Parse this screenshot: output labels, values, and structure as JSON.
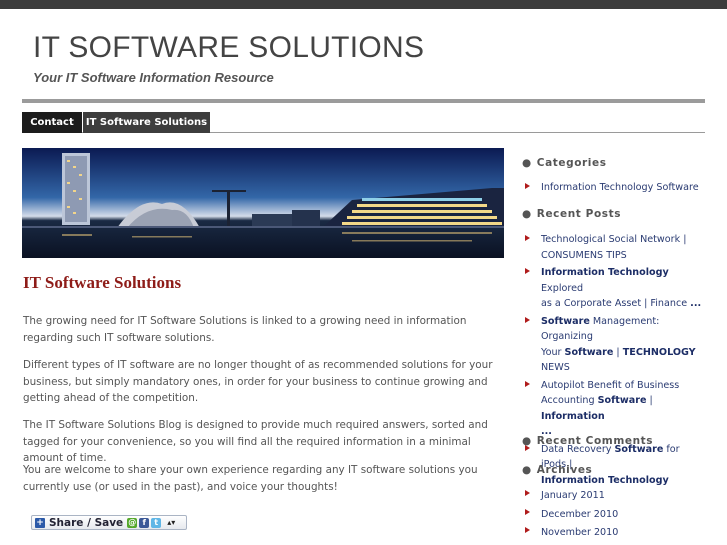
{
  "site": {
    "title": "IT SOFTWARE SOLUTIONS",
    "tagline": "Your IT Software Information Resource"
  },
  "nav": {
    "items": [
      "Contact",
      "IT Software Solutions"
    ]
  },
  "post": {
    "title": "IT Software Solutions",
    "paragraphs": [
      "The growing need for IT Software Solutions is linked to a growing need in information regarding such IT software solutions.",
      "Different types of IT software are no longer thought of as recommended solutions for your business, but simply  mandatory ones, in order for your business to continue growing and getting ahead of the competition.",
      "The IT Software Solutions Blog is designed to provide much required answers, sorted and tagged for your convenience, so you will find all the required information in a minimal amount of time.",
      "You are welcome to share your own experience regarding any IT software solutions you currently use (or used in the past), and voice your thoughts!"
    ],
    "share_label": "Share / Save",
    "share_arrows": "▴▾"
  },
  "sidebar": {
    "bullet": "●",
    "categories": {
      "heading": "Categories",
      "items": [
        "Information Technology Software"
      ]
    },
    "recent_posts": {
      "heading": "Recent Posts",
      "items": [
        {
          "lines": [
            [
              {
                "t": "Technological Social Network |",
                "b": false
              }
            ],
            [
              {
                "t": "CONSUMENS TIPS",
                "b": false
              }
            ]
          ]
        },
        {
          "lines": [
            [
              {
                "t": "Information Technology",
                "b": true
              },
              {
                "t": " Explored",
                "b": false
              }
            ],
            [
              {
                "t": "as a Corporate Asset | Finance ",
                "b": false
              },
              {
                "t": "...",
                "b": true
              }
            ]
          ]
        },
        {
          "lines": [
            [
              {
                "t": "Software",
                "b": true
              },
              {
                "t": " Management: Organizing",
                "b": false
              }
            ],
            [
              {
                "t": "Your ",
                "b": false
              },
              {
                "t": "Software",
                "b": true
              },
              {
                "t": " | ",
                "b": false
              },
              {
                "t": "TECHNOLOGY",
                "b": true
              }
            ],
            [
              {
                "t": "NEWS",
                "b": false
              }
            ]
          ]
        },
        {
          "lines": [
            [
              {
                "t": "Autopilot Benefit of Business",
                "b": false
              }
            ],
            [
              {
                "t": "Accounting ",
                "b": false
              },
              {
                "t": "Software",
                "b": true
              },
              {
                "t": " | ",
                "b": false
              },
              {
                "t": "Information",
                "b": true
              }
            ],
            [
              {
                "t": "...",
                "b": true
              }
            ]
          ]
        },
        {
          "lines": [
            [
              {
                "t": "Data Recovery ",
                "b": false
              },
              {
                "t": "Software",
                "b": true
              },
              {
                "t": " for iPods |",
                "b": false
              }
            ],
            [
              {
                "t": "Information Technology",
                "b": true
              }
            ]
          ]
        }
      ]
    },
    "recent_comments": {
      "heading": "Recent Comments"
    },
    "archives": {
      "heading": "Archives",
      "items": [
        "January 2011",
        "December 2010",
        "November 2010"
      ]
    }
  },
  "colors": {
    "post_title": "#8e1c18",
    "link": "#2a3b72",
    "bullet_arrow": "#b01c1c",
    "nav_bg": "#1c1c1c"
  }
}
